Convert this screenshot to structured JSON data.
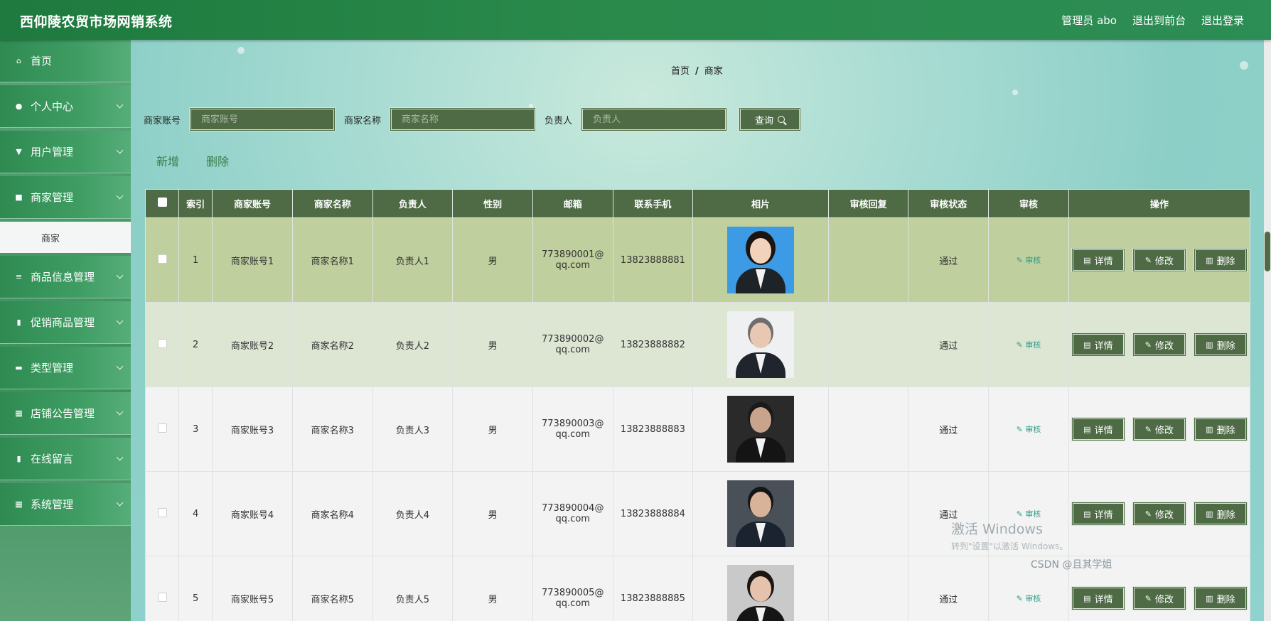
{
  "app": {
    "title": "西仰陵农贸市场网销系统"
  },
  "header": {
    "user": "管理员 abo",
    "to_front": "退出到前台",
    "logout": "退出登录"
  },
  "sidebar": {
    "items": [
      {
        "label": "首页",
        "icon": "home-icon"
      },
      {
        "label": "个人中心",
        "icon": "user-icon"
      },
      {
        "label": "用户管理",
        "icon": "users-icon"
      },
      {
        "label": "商家管理",
        "icon": "shop-icon"
      },
      {
        "label": "商品信息管理",
        "icon": "list-icon"
      },
      {
        "label": "促销商品管理",
        "icon": "clipboard-icon"
      },
      {
        "label": "类型管理",
        "icon": "category-icon"
      },
      {
        "label": "店铺公告管理",
        "icon": "grid-icon"
      },
      {
        "label": "在线留言",
        "icon": "clipboard-icon"
      },
      {
        "label": "系统管理",
        "icon": "grid-icon"
      }
    ],
    "sub_item": "商家"
  },
  "breadcrumb": {
    "home": "首页",
    "sep": "/",
    "current": "商家"
  },
  "search": {
    "account_label": "商家账号",
    "account_placeholder": "商家账号",
    "name_label": "商家名称",
    "name_placeholder": "商家名称",
    "owner_label": "负责人",
    "owner_placeholder": "负责人",
    "query_button": "查询"
  },
  "actions": {
    "add": "新增",
    "delete": "删除"
  },
  "table": {
    "headers": [
      "索引",
      "商家账号",
      "商家名称",
      "负责人",
      "性别",
      "邮箱",
      "联系手机",
      "相片",
      "审核回复",
      "审核状态",
      "审核",
      "操作"
    ],
    "rows": [
      {
        "index": "1",
        "account": "商家账号1",
        "name": "商家名称1",
        "owner": "负责人1",
        "gender": "男",
        "email1": "773890001@",
        "email2": "qq.com",
        "phone": "13823888881",
        "reply": "",
        "status": "通过",
        "audit": "审核"
      },
      {
        "index": "2",
        "account": "商家账号2",
        "name": "商家名称2",
        "owner": "负责人2",
        "gender": "男",
        "email1": "773890002@",
        "email2": "qq.com",
        "phone": "13823888882",
        "reply": "",
        "status": "通过",
        "audit": "审核"
      },
      {
        "index": "3",
        "account": "商家账号3",
        "name": "商家名称3",
        "owner": "负责人3",
        "gender": "男",
        "email1": "773890003@",
        "email2": "qq.com",
        "phone": "13823888883",
        "reply": "",
        "status": "通过",
        "audit": "审核"
      },
      {
        "index": "4",
        "account": "商家账号4",
        "name": "商家名称4",
        "owner": "负责人4",
        "gender": "男",
        "email1": "773890004@",
        "email2": "qq.com",
        "phone": "13823888884",
        "reply": "",
        "status": "通过",
        "audit": "审核"
      },
      {
        "index": "5",
        "account": "商家账号5",
        "name": "商家名称5",
        "owner": "负责人5",
        "gender": "男",
        "email1": "773890005@",
        "email2": "qq.com",
        "phone": "13823888885",
        "reply": "",
        "status": "通过",
        "audit": "审核"
      }
    ],
    "op_detail": "详情",
    "op_edit": "修改",
    "op_delete": "删除"
  },
  "overlay": {
    "win_line1": "激活 Windows",
    "win_line2": "转到\"设置\"以激活 Windows。",
    "csdn": "CSDN @且其学姐"
  }
}
